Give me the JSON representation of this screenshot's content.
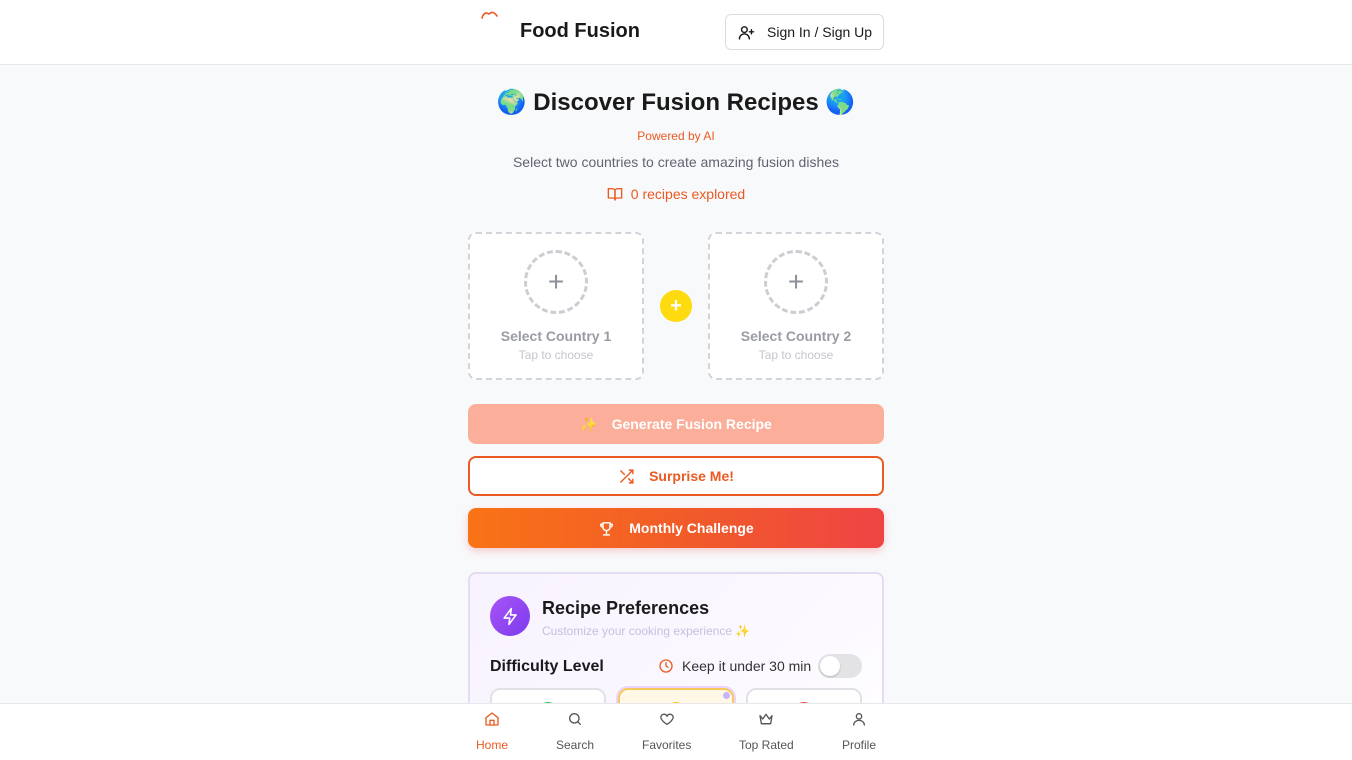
{
  "header": {
    "brand": "Food Fusion",
    "sign_in_label": "Sign In / Sign Up"
  },
  "hero": {
    "title": "🌍 Discover Fusion Recipes 🌎",
    "powered_by": "Powered by AI",
    "subtitle": "Select two countries to create amazing fusion dishes",
    "explored": "0 recipes explored"
  },
  "countries": [
    {
      "title": "Select Country 1",
      "hint": "Tap to choose"
    },
    {
      "title": "Select Country 2",
      "hint": "Tap to choose"
    }
  ],
  "actions": {
    "generate_icon": "✨",
    "generate_label": "Generate Fusion Recipe",
    "surprise_label": "Surprise Me!",
    "challenge_label": "Monthly Challenge"
  },
  "preferences": {
    "title": "Recipe Preferences",
    "subtitle": "Customize your cooking experience ✨",
    "difficulty_label": "Difficulty Level",
    "quick_label": "Keep it under 30 min",
    "quick_enabled": false,
    "difficulty_colors": [
      "#22c55e",
      "#facc15",
      "#ef4444"
    ],
    "selected_difficulty_index": 1
  },
  "nav": {
    "items": [
      {
        "label": "Home",
        "icon": "home-icon",
        "active": true
      },
      {
        "label": "Search",
        "icon": "search-icon",
        "active": false
      },
      {
        "label": "Favorites",
        "icon": "heart-icon",
        "active": false
      },
      {
        "label": "Top Rated",
        "icon": "crown-icon",
        "active": false
      },
      {
        "label": "Profile",
        "icon": "user-icon",
        "active": false
      }
    ]
  },
  "colors": {
    "accent": "#ea5a22",
    "join_badge": "#fddb0f",
    "purple": "#7c3aed"
  }
}
